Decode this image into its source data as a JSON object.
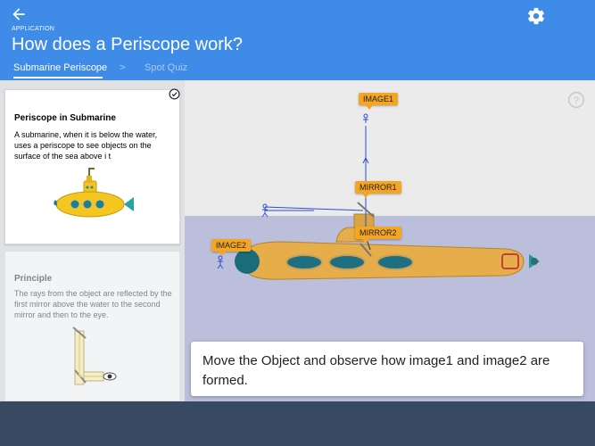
{
  "header": {
    "app_label": "APPLICATION",
    "title": "How does a Periscope work?",
    "tabs": [
      {
        "label": "Submarine Periscope",
        "active": true
      },
      {
        "label": "Spot Quiz",
        "active": false
      }
    ],
    "tab_separator": ">",
    "color": "#3e8ce8"
  },
  "icons": {
    "back": "arrow-left-icon",
    "settings": "gear-icon",
    "help": "help-circle-icon",
    "check": "check-circle-icon"
  },
  "sidebar": {
    "cards": [
      {
        "title": "Periscope in Submarine",
        "text": "A submarine, when it is below the water, uses a periscope to see objects on the surface of the sea above i t",
        "image": "yellow-submarine",
        "completed": true
      },
      {
        "title": "Principle",
        "text": "The rays from the object are reflected by the first mirror above the water to the second mirror and then to the eye.",
        "image": "periscope-diagram"
      }
    ]
  },
  "simulation": {
    "labels": {
      "image1": "IMAGE1",
      "mirror1": "MIRROR1",
      "mirror2": "MIRROR2",
      "image2": "IMAGE2"
    },
    "sea_color": "#bbbfdc",
    "instruction": "Move the Object and observe how image1 and image2 are formed."
  }
}
